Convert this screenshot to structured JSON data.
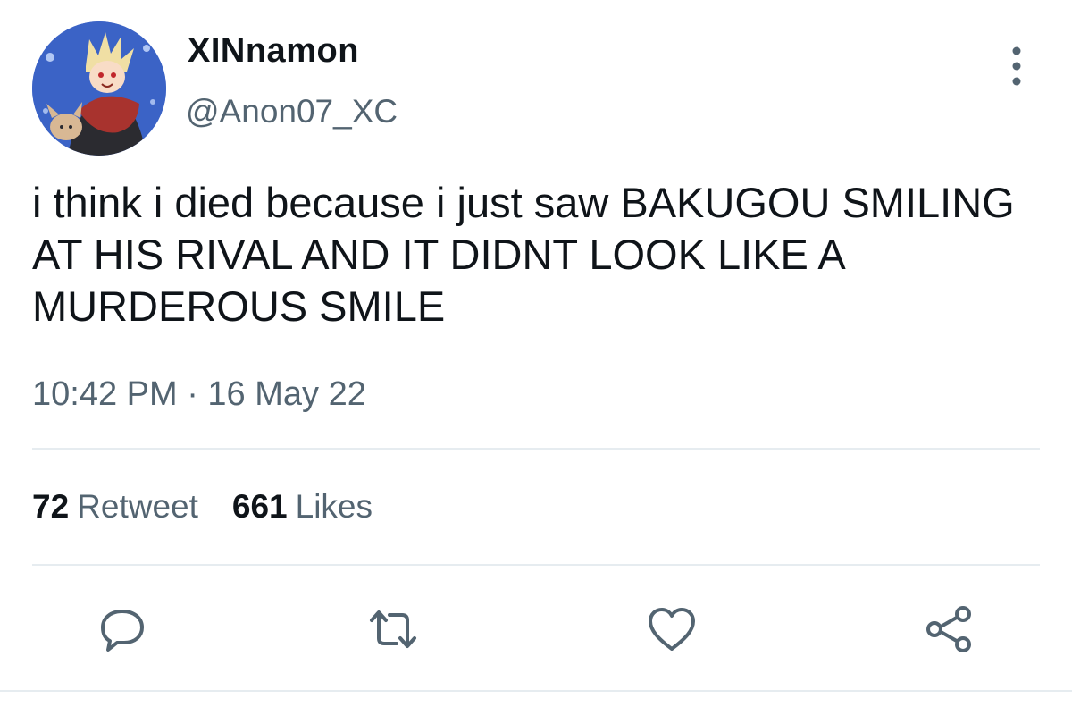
{
  "user": {
    "display_name": "XINnamon",
    "handle": "@Anon07_XC"
  },
  "tweet": {
    "text": "i think i died because i just saw BAKUGOU SMILING AT HIS RIVAL AND IT DIDNT LOOK LIKE A MURDEROUS SMILE",
    "timestamp": "10:42 PM · 16 May 22"
  },
  "stats": {
    "retweets_count": "72",
    "retweets_label": "Retweet",
    "likes_count": "661",
    "likes_label": "Likes"
  },
  "icons": {
    "more": "more-vertical-icon",
    "reply": "reply-icon",
    "retweet": "retweet-icon",
    "like": "heart-icon",
    "share": "share-icon"
  },
  "colors": {
    "text_primary": "#0f1419",
    "text_secondary": "#536471",
    "divider": "#e6ecf0"
  }
}
